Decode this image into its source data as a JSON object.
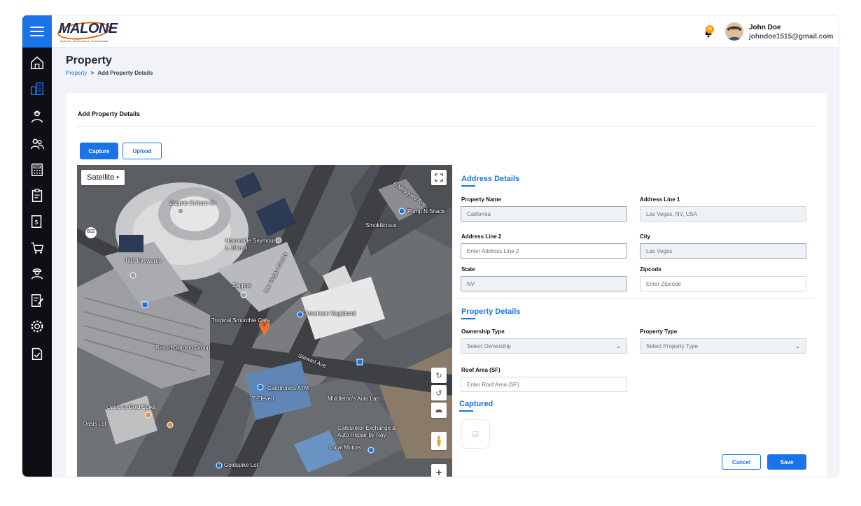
{
  "brand": {
    "logo_text": "MALONE",
    "logo_sub": "ROOFING · METAL WALLS · MAINTENANCE",
    "accent": "#1a73e8",
    "sidebar_bg": "#0d0f14"
  },
  "header": {
    "notification_count": "35",
    "user_name": "John Doe",
    "user_email": "johndoe1515@gmail.com"
  },
  "sidebar": {
    "items": [
      "home-icon",
      "buildings-icon",
      "worker-icon",
      "users-icon",
      "calculator-icon",
      "clipboard-icon",
      "invoice-icon",
      "cart-icon",
      "engineer-icon",
      "edit-document-icon",
      "gear-icon",
      "document-check-icon"
    ]
  },
  "page": {
    "title": "Property",
    "breadcrumb_parent": "Property",
    "breadcrumb_sep": ">",
    "breadcrumb_current": "Add Property Details"
  },
  "card": {
    "title": "Add Property Details",
    "capture_label": "Capture",
    "upload_label": "Upload"
  },
  "map": {
    "type_label": "Satellite",
    "labels": [
      "Zappos Culture Kit",
      "Honorable Seymour L. Brown",
      "TNT Fireworks",
      "Zappos",
      "Tropical Smoothie Cafe",
      "American Vagabond",
      "Resort Gaming Group",
      "Cardtronics ATM",
      "7-Eleven",
      "Middleton's Auto Lab",
      "Oasis at Gold Spike",
      "Oasis Lot",
      "Carburetor Exchange & Auto Repair by Ray",
      "Local Motors",
      "Goldspike Lot",
      "Pump N Snack",
      "Smokilicious",
      "Las Vegas Blvd N",
      "Stewart Ave",
      "E Mesquite Ave",
      "602"
    ]
  },
  "address": {
    "section_title": "Address Details",
    "property_name_label": "Property Name",
    "property_name_value": "California",
    "address1_label": "Address Line 1",
    "address1_value": "Las Vegas, NV, USA",
    "address2_label": "Address Line 2",
    "address2_placeholder": "Enter Address Line 2",
    "city_label": "City",
    "city_value": "Las Vegas",
    "state_label": "State",
    "state_value": "NV",
    "zip_label": "Zipcode",
    "zip_placeholder": "Enter Zipcode"
  },
  "property": {
    "section_title": "Property Details",
    "ownership_label": "Ownership Type",
    "ownership_value": "Select Ownership",
    "type_label": "Property Type",
    "type_value": "Select Property Type",
    "roof_label": "Roof Area (SF)",
    "roof_placeholder": "Enter Roof Area (SF)"
  },
  "captured": {
    "title": "Captured"
  },
  "actions": {
    "cancel_label": "Cancel",
    "save_label": "Save"
  }
}
